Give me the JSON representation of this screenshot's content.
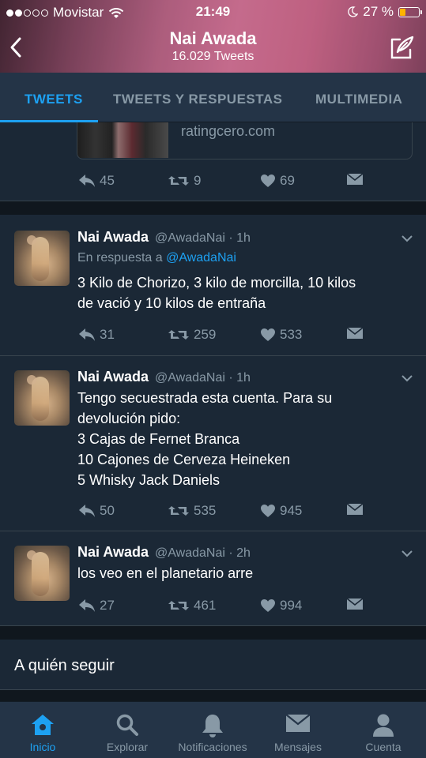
{
  "status_bar": {
    "carrier": "Movistar",
    "time": "21:49",
    "battery_percent": "27 %",
    "battery_level": 0.27,
    "signal_bars": 2
  },
  "header": {
    "title": "Nai Awada",
    "subtitle": "16.029 Tweets"
  },
  "tabs": [
    {
      "label": "TWEETS",
      "active": true
    },
    {
      "label": "TWEETS Y RESPUESTAS",
      "active": false
    },
    {
      "label": "MULTIMEDIA",
      "active": false
    }
  ],
  "top_card": {
    "link_domain": "ratingcero.com",
    "replies": "45",
    "retweets": "9",
    "likes": "69"
  },
  "tweets": [
    {
      "name": "Nai Awada",
      "handle": "@AwadaNai · 1h",
      "reply_prefix": "En respuesta a",
      "reply_mention": "@AwadaNai",
      "lines": [
        "3 Kilo de Chorizo, 3 kilo de morcilla, 10 kilos",
        "de vació y 10 kilos de entraña"
      ],
      "replies": "31",
      "retweets": "259",
      "likes": "533"
    },
    {
      "name": "Nai Awada",
      "handle": "@AwadaNai · 1h",
      "lines": [
        "Tengo secuestrada esta cuenta. Para su",
        "devolución pido:",
        "3 Cajas de Fernet Branca",
        "10 Cajones de Cerveza Heineken",
        "5 Whisky Jack Daniels"
      ],
      "replies": "50",
      "retweets": "535",
      "likes": "945"
    },
    {
      "name": "Nai Awada",
      "handle": "@AwadaNai · 2h",
      "lines": [
        "los veo en el planetario arre"
      ],
      "replies": "27",
      "retweets": "461",
      "likes": "994"
    }
  ],
  "who_to_follow": "A quién seguir",
  "bottom_nav": [
    {
      "label": "Inicio",
      "icon": "home-icon",
      "active": true
    },
    {
      "label": "Explorar",
      "icon": "search-icon",
      "active": false
    },
    {
      "label": "Notificaciones",
      "icon": "bell-icon",
      "active": false
    },
    {
      "label": "Mensajes",
      "icon": "envelope-icon",
      "active": false
    },
    {
      "label": "Cuenta",
      "icon": "person-icon",
      "active": false
    }
  ],
  "colors": {
    "accent": "#1da1f2",
    "background": "#10171e",
    "card": "#1b2836",
    "bar": "#243447",
    "muted": "#8899a6",
    "battery": "#ffb400"
  }
}
